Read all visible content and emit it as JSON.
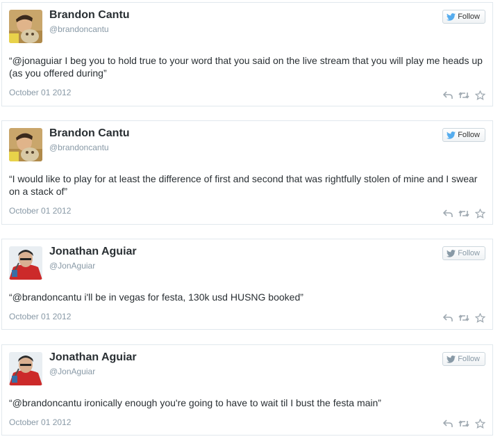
{
  "tweets": [
    {
      "name": "Brandon Cantu",
      "handle": "@brandoncantu",
      "text": "“@jonaguiar I beg you to hold true to your word that you said on the live stream that you will play me heads up (as you offered during”",
      "date": "October 01 2012",
      "follow_label": "Follow",
      "follow_style": "active",
      "avatar": "brandon"
    },
    {
      "name": "Brandon Cantu",
      "handle": "@brandoncantu",
      "text": "“I would like to play for at least the difference of first and second that was rightfully stolen of mine and I swear on a stack of”",
      "date": "October 01 2012",
      "follow_label": "Follow",
      "follow_style": "active",
      "avatar": "brandon"
    },
    {
      "name": "Jonathan Aguiar",
      "handle": "@JonAguiar",
      "text": "“@brandoncantu i'll be in vegas for festa, 130k usd HUSNG booked”",
      "date": "October 01 2012",
      "follow_label": "Follow",
      "follow_style": "muted",
      "avatar": "jonathan"
    },
    {
      "name": "Jonathan Aguiar",
      "handle": "@JonAguiar",
      "text": "“@brandoncantu ironically enough you're going to have to wait til I bust the festa main”",
      "date": "October 01 2012",
      "follow_label": "Follow",
      "follow_style": "muted",
      "avatar": "jonathan"
    }
  ],
  "colors": {
    "twitter_blue": "#55acee",
    "muted_bird": "#8899a6",
    "action_icon": "#a0aab2"
  }
}
